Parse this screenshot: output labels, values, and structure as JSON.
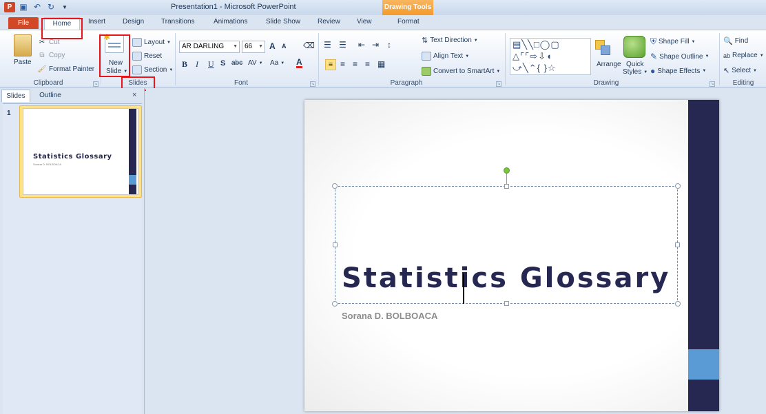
{
  "window": {
    "title": "Presentation1 - Microsoft PowerPoint",
    "contextual_tab": "Drawing Tools"
  },
  "tabs": {
    "file": "File",
    "home": "Home",
    "insert": "Insert",
    "design": "Design",
    "transitions": "Transitions",
    "animations": "Animations",
    "slideshow": "Slide Show",
    "review": "Review",
    "view": "View",
    "format": "Format"
  },
  "clipboard": {
    "paste": "Paste",
    "cut": "Cut",
    "copy": "Copy",
    "format_painter": "Format Painter",
    "label": "Clipboard"
  },
  "slides_group": {
    "new_slide_line1": "New",
    "new_slide_line2": "Slide",
    "layout": "Layout",
    "reset": "Reset",
    "section": "Section",
    "label": "Slides"
  },
  "font": {
    "family": "AR DARLING",
    "size": "66",
    "grow": "A",
    "shrink": "A",
    "bold": "B",
    "italic": "I",
    "underline": "U",
    "shadow": "S",
    "strike": "abc",
    "spacing": "AV",
    "case": "Aa",
    "color": "A",
    "label": "Font"
  },
  "paragraph": {
    "text_direction": "Text Direction",
    "align_text": "Align Text",
    "convert_smartart": "Convert to SmartArt",
    "label": "Paragraph"
  },
  "drawing": {
    "arrange": "Arrange",
    "quick_styles_line1": "Quick",
    "quick_styles_line2": "Styles",
    "shape_fill": "Shape Fill",
    "shape_outline": "Shape Outline",
    "shape_effects": "Shape Effects",
    "label": "Drawing"
  },
  "editing": {
    "find": "Find",
    "replace": "Replace",
    "select": "Select",
    "label": "Editing"
  },
  "panel": {
    "slides_tab": "Slides",
    "outline_tab": "Outline",
    "close": "×",
    "slide_number": "1"
  },
  "slide": {
    "title": "Statistics Glossary",
    "subtitle": "Sorana D. BOLBOACA"
  },
  "colors": {
    "accent_bar": "#262852",
    "accent_block": "#5b9bd5",
    "file_tab": "#d24726",
    "highlight": "#e8161b",
    "rotate_handle": "#7fc241"
  },
  "icons": [
    "ppt-icon",
    "save-icon",
    "undo-icon",
    "redo-icon",
    "paste-icon",
    "cut-icon",
    "copy-icon",
    "format-painter-icon",
    "new-slide-icon",
    "layout-icon",
    "reset-icon",
    "section-icon",
    "find-icon",
    "replace-icon",
    "select-icon"
  ]
}
